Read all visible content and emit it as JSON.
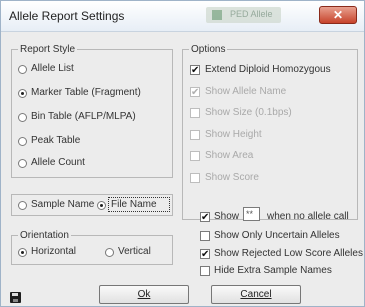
{
  "window": {
    "title": "Allele Report Settings",
    "background_title": "PED Allele",
    "close_symbol": "✕"
  },
  "report_style": {
    "legend": "Report Style",
    "options": [
      {
        "label": "Allele List",
        "selected": false
      },
      {
        "label": "Marker Table (Fragment)",
        "selected": true
      },
      {
        "label": "Bin Table (AFLP/MLPA)",
        "selected": false
      },
      {
        "label": "Peak Table",
        "selected": false
      },
      {
        "label": "Allele Count",
        "selected": false
      }
    ]
  },
  "name_choice": {
    "sample_name": {
      "label": "Sample Name",
      "selected": false
    },
    "file_name": {
      "label": "File Name",
      "selected": true
    }
  },
  "orientation": {
    "legend": "Orientation",
    "horizontal": {
      "label": "Horizontal",
      "selected": true
    },
    "vertical": {
      "label": "Vertical",
      "selected": false
    }
  },
  "options": {
    "legend": "Options",
    "items": [
      {
        "label": "Extend Diploid Homozygous",
        "checked": true,
        "enabled": true
      },
      {
        "label": "Show Allele Name",
        "checked": true,
        "enabled": false
      },
      {
        "label": "Show Size (0.1bps)",
        "checked": false,
        "enabled": false
      },
      {
        "label": "Show Height",
        "checked": false,
        "enabled": false
      },
      {
        "label": "Show Area",
        "checked": false,
        "enabled": false
      },
      {
        "label": "Show Score",
        "checked": false,
        "enabled": false
      }
    ]
  },
  "extra_options": {
    "show_no_call": {
      "label_before": "Show",
      "value": "**",
      "label_after": "when no allele call",
      "checked": true
    },
    "items": [
      {
        "label": "Show Only Uncertain Alleles",
        "checked": false
      },
      {
        "label": "Show Rejected Low Score Alleles",
        "checked": true
      },
      {
        "label": "Hide Extra Sample Names",
        "checked": false
      }
    ]
  },
  "buttons": {
    "ok": "Ok",
    "cancel": "Cancel"
  },
  "check_symbol": "✔"
}
